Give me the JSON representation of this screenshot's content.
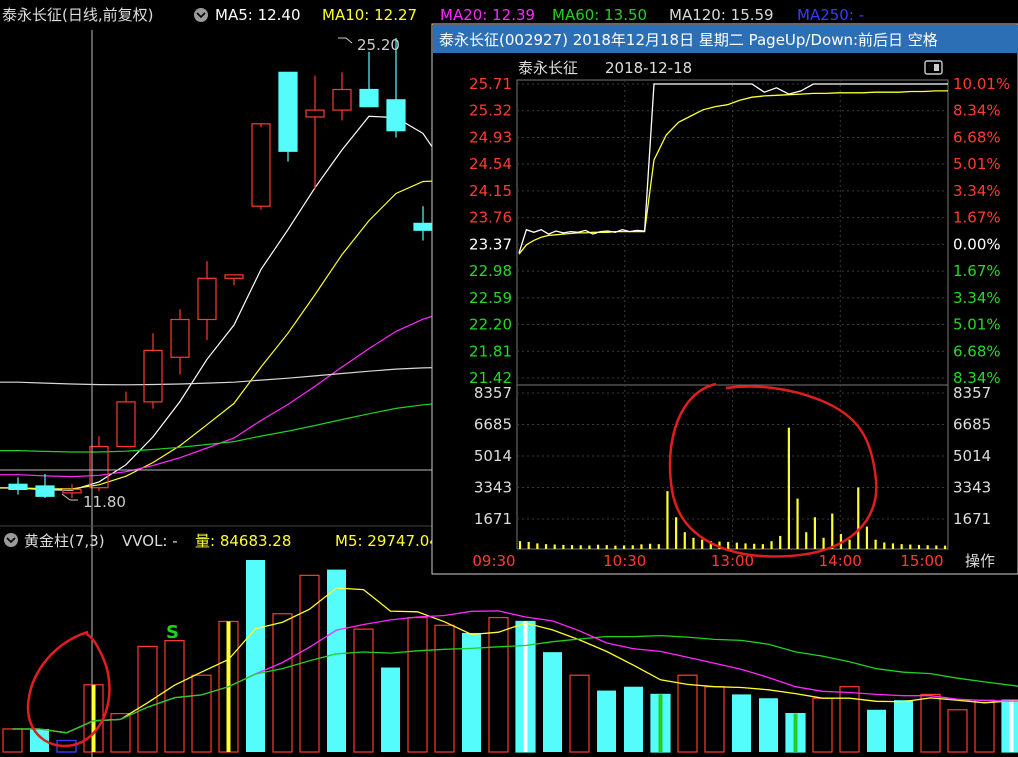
{
  "colors": {
    "bg": "#000000",
    "up": "#ff3b30",
    "down": "#54fcfc",
    "ma5": "#ffffff",
    "ma10": "#ffff2e",
    "ma20": "#ff28ff",
    "ma60": "#22d022",
    "ma120": "#d8d8d8",
    "ma250": "#3a3aff",
    "grid": "#2a2a2a",
    "popup_border": "#cfcfcf",
    "popup_title_bg": "#2c6fb5",
    "price_line": "#ffffff",
    "avg_line": "#ffff33",
    "green_text": "#27d827",
    "red_text": "#ff3b30",
    "annotation": "#e31d1d"
  },
  "header": {
    "title": "泰永长征(日线,前复权)",
    "ma5": "MA5: 12.40",
    "ma10": "MA10: 12.27",
    "ma20": "MA20: 12.39",
    "ma60": "MA60: 13.50",
    "ma120": "MA120: 15.59",
    "ma250": "MA250: -"
  },
  "chart_data": [
    {
      "type": "candlestick",
      "high_label": "25.20",
      "low_label": "11.80",
      "candles": [
        {
          "o": 12.2,
          "h": 12.4,
          "l": 11.9,
          "c": 12.05
        },
        {
          "o": 12.15,
          "h": 12.5,
          "l": 11.8,
          "c": 11.85
        },
        {
          "o": 11.95,
          "h": 12.2,
          "l": 11.8,
          "c": 12.05
        },
        {
          "o": 12.1,
          "h": 13.6,
          "l": 12.0,
          "c": 13.3
        },
        {
          "o": 13.3,
          "h": 14.9,
          "l": 13.3,
          "c": 14.6
        },
        {
          "o": 14.6,
          "h": 16.6,
          "l": 14.4,
          "c": 16.1
        },
        {
          "o": 15.9,
          "h": 17.3,
          "l": 15.4,
          "c": 17.0
        },
        {
          "o": 17.0,
          "h": 18.7,
          "l": 16.4,
          "c": 18.2
        },
        {
          "o": 18.2,
          "h": 18.3,
          "l": 18.0,
          "c": 18.3
        },
        {
          "o": 20.3,
          "h": 22.6,
          "l": 20.2,
          "c": 22.7
        },
        {
          "o": 24.2,
          "h": 24.2,
          "l": 21.6,
          "c": 21.9
        },
        {
          "o": 22.9,
          "h": 24.1,
          "l": 20.8,
          "c": 23.1
        },
        {
          "o": 23.1,
          "h": 24.2,
          "l": 22.8,
          "c": 23.7
        },
        {
          "o": 23.7,
          "h": 24.8,
          "l": 23.3,
          "c": 23.2
        },
        {
          "o": 23.4,
          "h": 25.2,
          "l": 22.3,
          "c": 22.5
        },
        {
          "o": 19.8,
          "h": 20.3,
          "l": 19.3,
          "c": 19.6
        },
        {
          "o": 17.3,
          "h": 18.3,
          "l": 17.1,
          "c": 17.3
        },
        {
          "o": 17.7,
          "h": 18.9,
          "l": 17.4,
          "c": 18.5
        }
      ]
    },
    {
      "type": "line",
      "title": "泰永长征",
      "date": "2018-12-18",
      "x": [
        "09:30",
        "10:30",
        "13:00",
        "14:00",
        "15:00"
      ],
      "prev_close": 23.37,
      "price_ticks": [
        "25.71",
        "25.32",
        "24.93",
        "24.54",
        "24.15",
        "23.76",
        "23.37",
        "22.98",
        "22.59",
        "22.20",
        "21.81",
        "21.42"
      ],
      "pct_ticks": [
        "10.01%",
        "8.34%",
        "6.68%",
        "5.01%",
        "3.34%",
        "1.67%",
        "0.00%",
        "1.67%",
        "3.34%",
        "5.01%",
        "6.68%",
        "8.34%"
      ],
      "vol_ticks": [
        "8357",
        "6685",
        "5014",
        "3343",
        "1671"
      ],
      "ylim": [
        21.03,
        25.71
      ],
      "series": [
        {
          "name": "价格",
          "values": [
            23.02,
            23.39,
            23.35,
            23.39,
            23.32,
            23.37,
            23.34,
            23.36,
            23.35,
            23.38,
            23.32,
            23.36,
            23.37,
            23.35,
            23.39,
            23.36,
            23.38,
            23.37,
            25.71,
            25.71,
            25.71,
            25.71,
            25.71,
            25.71,
            25.71,
            25.71,
            25.71,
            25.58,
            25.65,
            25.55,
            25.6,
            25.71,
            25.71,
            25.71,
            25.71,
            25.71,
            25.71,
            25.71,
            25.71,
            25.71,
            25.71,
            25.71,
            25.71
          ]
        },
        {
          "name": "均价",
          "values": [
            23.0,
            23.15,
            23.22,
            23.27,
            23.3,
            23.31,
            23.32,
            23.33,
            23.34,
            23.34,
            23.35,
            23.35,
            23.35,
            23.36,
            23.36,
            23.36,
            23.36,
            23.36,
            24.5,
            24.9,
            25.1,
            25.2,
            25.3,
            25.35,
            25.38,
            25.45,
            25.5,
            25.52,
            25.53,
            25.54,
            25.55,
            25.56,
            25.56,
            25.57,
            25.57,
            25.57,
            25.58,
            25.58,
            25.58,
            25.59,
            25.59,
            25.6,
            25.6
          ]
        }
      ],
      "volume": [
        420,
        380,
        300,
        260,
        240,
        220,
        210,
        200,
        190,
        230,
        210,
        180,
        190,
        200,
        250,
        280,
        260,
        3100,
        1700,
        900,
        600,
        500,
        420,
        400,
        380,
        340,
        300,
        280,
        260,
        420,
        700,
        6500,
        2700,
        900,
        1700,
        600,
        1900,
        800,
        500,
        3300,
        1200,
        500,
        350,
        300,
        260,
        240,
        220,
        200,
        190,
        180
      ],
      "operate_label": "操作"
    },
    {
      "type": "bar",
      "title": "黄金柱(7,3)",
      "vvol": "VVOL: -",
      "vol": "量: 84683.28",
      "m5": "M5: 29747.04",
      "signal": "S",
      "bars": [
        {
          "v": 0.12,
          "t": "up"
        },
        {
          "v": 0.12,
          "t": "down"
        },
        {
          "v": 0.06,
          "t": "blue"
        },
        {
          "v": 0.35,
          "t": "yellow"
        },
        {
          "v": 0.2,
          "t": "up"
        },
        {
          "v": 0.55,
          "t": "up"
        },
        {
          "v": 0.58,
          "t": "up"
        },
        {
          "v": 0.4,
          "t": "up"
        },
        {
          "v": 0.68,
          "t": "yellow"
        },
        {
          "v": 1.0,
          "t": "down"
        },
        {
          "v": 0.72,
          "t": "up"
        },
        {
          "v": 0.92,
          "t": "up"
        },
        {
          "v": 0.95,
          "t": "down"
        },
        {
          "v": 0.64,
          "t": "up"
        },
        {
          "v": 0.44,
          "t": "down"
        },
        {
          "v": 0.7,
          "t": "up"
        },
        {
          "v": 0.66,
          "t": "up"
        },
        {
          "v": 0.62,
          "t": "down"
        },
        {
          "v": 0.7,
          "t": "up"
        },
        {
          "v": 0.68,
          "t": "white"
        },
        {
          "v": 0.52,
          "t": "down"
        },
        {
          "v": 0.4,
          "t": "up"
        },
        {
          "v": 0.32,
          "t": "down"
        },
        {
          "v": 0.34,
          "t": "down"
        },
        {
          "v": 0.3,
          "t": "green"
        },
        {
          "v": 0.4,
          "t": "up"
        },
        {
          "v": 0.34,
          "t": "up"
        },
        {
          "v": 0.3,
          "t": "down"
        },
        {
          "v": 0.28,
          "t": "down"
        },
        {
          "v": 0.2,
          "t": "green"
        },
        {
          "v": 0.28,
          "t": "up"
        },
        {
          "v": 0.34,
          "t": "up"
        },
        {
          "v": 0.22,
          "t": "down"
        },
        {
          "v": 0.27,
          "t": "down"
        },
        {
          "v": 0.3,
          "t": "up"
        },
        {
          "v": 0.22,
          "t": "up"
        },
        {
          "v": 0.27,
          "t": "up"
        },
        {
          "v": 0.27,
          "t": "white"
        },
        {
          "v": 0.3,
          "t": "up"
        }
      ]
    }
  ],
  "popup": {
    "title": "泰永长征(002927)  2018年12月18日  星期二  PageUp/Down:前后日  空格"
  }
}
